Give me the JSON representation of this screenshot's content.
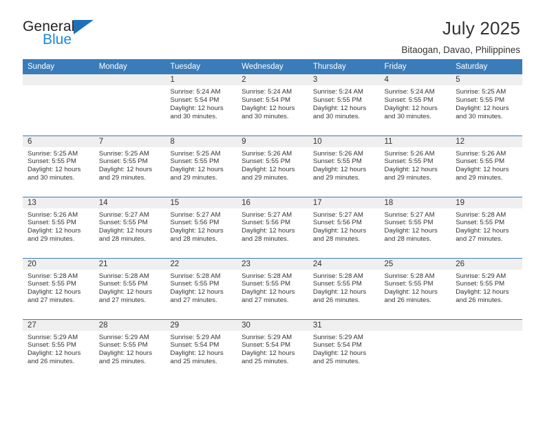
{
  "brand": {
    "name_top": "General",
    "name_bottom": "Blue",
    "triangle_color": "#1e71b8",
    "blue_color": "#1e87d6"
  },
  "header": {
    "title": "July 2025",
    "location": "Bitaogan, Davao, Philippines"
  },
  "theme": {
    "header_bg": "#3a7cba",
    "header_text": "#ffffff",
    "daynum_strip_bg": "#efefef",
    "body_text": "#333333",
    "separator": "#3a7cba"
  },
  "weekday_headers": [
    "Sunday",
    "Monday",
    "Tuesday",
    "Wednesday",
    "Thursday",
    "Friday",
    "Saturday"
  ],
  "labels": {
    "sunrise_prefix": "Sunrise:",
    "sunset_prefix": "Sunset:",
    "daylight_prefix": "Daylight:"
  },
  "weeks": [
    [
      {
        "day": "",
        "lines": []
      },
      {
        "day": "",
        "lines": []
      },
      {
        "day": "1",
        "lines": [
          "Sunrise: 5:24 AM",
          "Sunset: 5:54 PM",
          "Daylight: 12 hours",
          "and 30 minutes."
        ]
      },
      {
        "day": "2",
        "lines": [
          "Sunrise: 5:24 AM",
          "Sunset: 5:54 PM",
          "Daylight: 12 hours",
          "and 30 minutes."
        ]
      },
      {
        "day": "3",
        "lines": [
          "Sunrise: 5:24 AM",
          "Sunset: 5:55 PM",
          "Daylight: 12 hours",
          "and 30 minutes."
        ]
      },
      {
        "day": "4",
        "lines": [
          "Sunrise: 5:24 AM",
          "Sunset: 5:55 PM",
          "Daylight: 12 hours",
          "and 30 minutes."
        ]
      },
      {
        "day": "5",
        "lines": [
          "Sunrise: 5:25 AM",
          "Sunset: 5:55 PM",
          "Daylight: 12 hours",
          "and 30 minutes."
        ]
      }
    ],
    [
      {
        "day": "6",
        "lines": [
          "Sunrise: 5:25 AM",
          "Sunset: 5:55 PM",
          "Daylight: 12 hours",
          "and 30 minutes."
        ]
      },
      {
        "day": "7",
        "lines": [
          "Sunrise: 5:25 AM",
          "Sunset: 5:55 PM",
          "Daylight: 12 hours",
          "and 29 minutes."
        ]
      },
      {
        "day": "8",
        "lines": [
          "Sunrise: 5:25 AM",
          "Sunset: 5:55 PM",
          "Daylight: 12 hours",
          "and 29 minutes."
        ]
      },
      {
        "day": "9",
        "lines": [
          "Sunrise: 5:26 AM",
          "Sunset: 5:55 PM",
          "Daylight: 12 hours",
          "and 29 minutes."
        ]
      },
      {
        "day": "10",
        "lines": [
          "Sunrise: 5:26 AM",
          "Sunset: 5:55 PM",
          "Daylight: 12 hours",
          "and 29 minutes."
        ]
      },
      {
        "day": "11",
        "lines": [
          "Sunrise: 5:26 AM",
          "Sunset: 5:55 PM",
          "Daylight: 12 hours",
          "and 29 minutes."
        ]
      },
      {
        "day": "12",
        "lines": [
          "Sunrise: 5:26 AM",
          "Sunset: 5:55 PM",
          "Daylight: 12 hours",
          "and 29 minutes."
        ]
      }
    ],
    [
      {
        "day": "13",
        "lines": [
          "Sunrise: 5:26 AM",
          "Sunset: 5:55 PM",
          "Daylight: 12 hours",
          "and 29 minutes."
        ]
      },
      {
        "day": "14",
        "lines": [
          "Sunrise: 5:27 AM",
          "Sunset: 5:55 PM",
          "Daylight: 12 hours",
          "and 28 minutes."
        ]
      },
      {
        "day": "15",
        "lines": [
          "Sunrise: 5:27 AM",
          "Sunset: 5:56 PM",
          "Daylight: 12 hours",
          "and 28 minutes."
        ]
      },
      {
        "day": "16",
        "lines": [
          "Sunrise: 5:27 AM",
          "Sunset: 5:56 PM",
          "Daylight: 12 hours",
          "and 28 minutes."
        ]
      },
      {
        "day": "17",
        "lines": [
          "Sunrise: 5:27 AM",
          "Sunset: 5:56 PM",
          "Daylight: 12 hours",
          "and 28 minutes."
        ]
      },
      {
        "day": "18",
        "lines": [
          "Sunrise: 5:27 AM",
          "Sunset: 5:55 PM",
          "Daylight: 12 hours",
          "and 28 minutes."
        ]
      },
      {
        "day": "19",
        "lines": [
          "Sunrise: 5:28 AM",
          "Sunset: 5:55 PM",
          "Daylight: 12 hours",
          "and 27 minutes."
        ]
      }
    ],
    [
      {
        "day": "20",
        "lines": [
          "Sunrise: 5:28 AM",
          "Sunset: 5:55 PM",
          "Daylight: 12 hours",
          "and 27 minutes."
        ]
      },
      {
        "day": "21",
        "lines": [
          "Sunrise: 5:28 AM",
          "Sunset: 5:55 PM",
          "Daylight: 12 hours",
          "and 27 minutes."
        ]
      },
      {
        "day": "22",
        "lines": [
          "Sunrise: 5:28 AM",
          "Sunset: 5:55 PM",
          "Daylight: 12 hours",
          "and 27 minutes."
        ]
      },
      {
        "day": "23",
        "lines": [
          "Sunrise: 5:28 AM",
          "Sunset: 5:55 PM",
          "Daylight: 12 hours",
          "and 27 minutes."
        ]
      },
      {
        "day": "24",
        "lines": [
          "Sunrise: 5:28 AM",
          "Sunset: 5:55 PM",
          "Daylight: 12 hours",
          "and 26 minutes."
        ]
      },
      {
        "day": "25",
        "lines": [
          "Sunrise: 5:28 AM",
          "Sunset: 5:55 PM",
          "Daylight: 12 hours",
          "and 26 minutes."
        ]
      },
      {
        "day": "26",
        "lines": [
          "Sunrise: 5:29 AM",
          "Sunset: 5:55 PM",
          "Daylight: 12 hours",
          "and 26 minutes."
        ]
      }
    ],
    [
      {
        "day": "27",
        "lines": [
          "Sunrise: 5:29 AM",
          "Sunset: 5:55 PM",
          "Daylight: 12 hours",
          "and 26 minutes."
        ]
      },
      {
        "day": "28",
        "lines": [
          "Sunrise: 5:29 AM",
          "Sunset: 5:55 PM",
          "Daylight: 12 hours",
          "and 25 minutes."
        ]
      },
      {
        "day": "29",
        "lines": [
          "Sunrise: 5:29 AM",
          "Sunset: 5:54 PM",
          "Daylight: 12 hours",
          "and 25 minutes."
        ]
      },
      {
        "day": "30",
        "lines": [
          "Sunrise: 5:29 AM",
          "Sunset: 5:54 PM",
          "Daylight: 12 hours",
          "and 25 minutes."
        ]
      },
      {
        "day": "31",
        "lines": [
          "Sunrise: 5:29 AM",
          "Sunset: 5:54 PM",
          "Daylight: 12 hours",
          "and 25 minutes."
        ]
      },
      {
        "day": "",
        "lines": []
      },
      {
        "day": "",
        "lines": []
      }
    ]
  ]
}
